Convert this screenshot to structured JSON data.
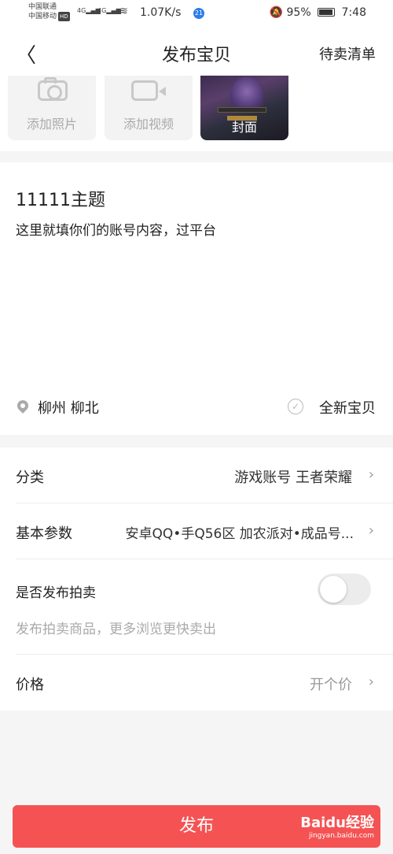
{
  "status_bar": {
    "carrier1": "中国联通",
    "carrier2": "中国移动",
    "hd": "HD",
    "sig1": "4G",
    "sig2": "4G",
    "speed": "1.07K/s",
    "notif": "21",
    "battery": "95%",
    "time": "7:48"
  },
  "nav": {
    "back": "〈",
    "title": "发布宝贝",
    "right": "待卖清单"
  },
  "media": {
    "add_photo": "添加照片",
    "add_video": "添加视频",
    "cover": "封面"
  },
  "content": {
    "title": "11111主题",
    "description": "这里就填你们的账号内容，过平台",
    "location": "柳州  柳北",
    "condition": "全新宝贝"
  },
  "rows": {
    "category_label": "分类",
    "category_value": "游戏账号 王者荣耀",
    "params_label": "基本参数",
    "params_value": "安卓QQ•手Q56区 加农派对•成品号...",
    "auction_label": "是否发布拍卖",
    "auction_desc": "发布拍卖商品，更多浏览更快卖出",
    "price_label": "价格",
    "price_value": "开个价"
  },
  "publish_label": "发布",
  "watermark": {
    "brand": "Baidu经验",
    "url": "jingyan.baidu.com"
  },
  "colors": {
    "accent": "#f55353"
  }
}
